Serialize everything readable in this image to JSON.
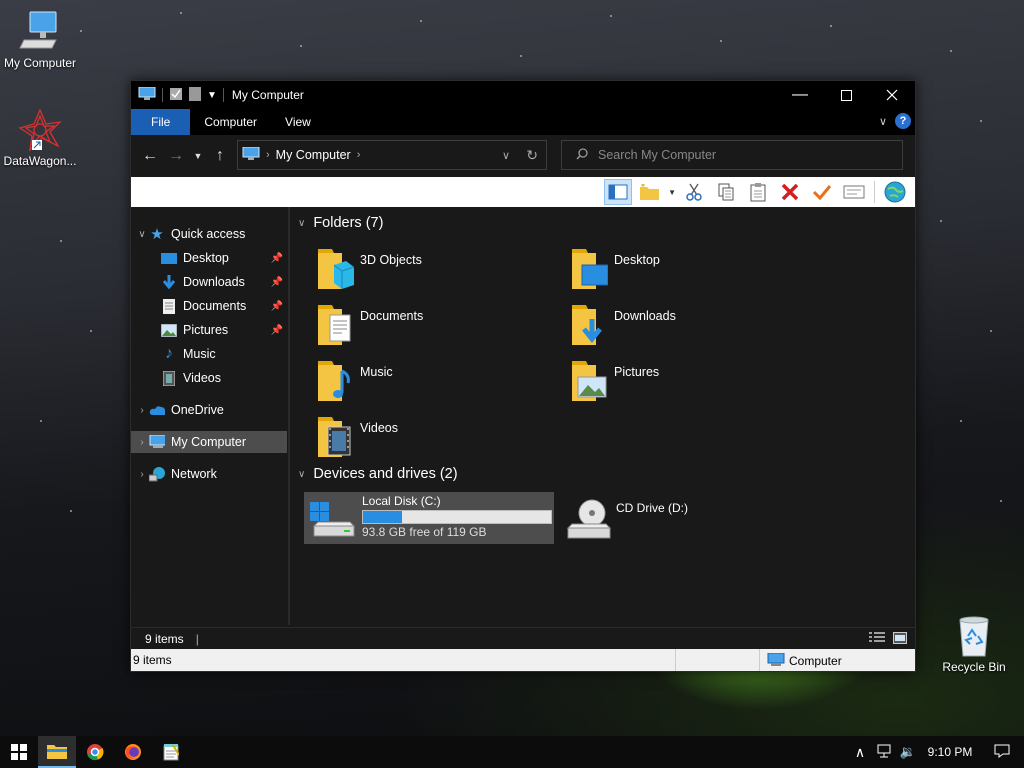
{
  "desktop": {
    "icons": [
      {
        "label": "My Computer"
      },
      {
        "label": "DataWagon..."
      },
      {
        "label": "Recycle Bin"
      }
    ]
  },
  "window": {
    "title": "My Computer",
    "ribbon_tabs": [
      "File",
      "Computer",
      "View"
    ],
    "address": "My Computer",
    "search_placeholder": "Search My Computer",
    "nav": {
      "quick_access": "Quick access",
      "quick_items": [
        "Desktop",
        "Downloads",
        "Documents",
        "Pictures",
        "Music",
        "Videos"
      ],
      "onedrive": "OneDrive",
      "my_computer": "My Computer",
      "network": "Network"
    },
    "folders_header": "Folders (7)",
    "folders": [
      "3D Objects",
      "Desktop",
      "Documents",
      "Downloads",
      "Music",
      "Pictures",
      "Videos"
    ],
    "drives_header": "Devices and drives (2)",
    "drives": [
      {
        "name": "Local Disk (C:)",
        "free_text": "93.8 GB free of 119 GB",
        "used_fraction": 0.21
      },
      {
        "name": "CD Drive (D:)"
      }
    ],
    "status_items": "9 items",
    "status_bottom_items": "9 items",
    "status_bottom_location": "Computer"
  },
  "taskbar": {
    "time": "9:10 PM"
  },
  "colors": {
    "accent": "#1a5fb4",
    "folder_yellow": "#f4c542",
    "progress": "#2a8ee0"
  }
}
